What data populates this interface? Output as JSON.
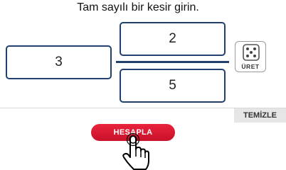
{
  "instruction": "Tam sayılı bir kesir girin.",
  "fraction": {
    "whole": "3",
    "numerator": "2",
    "denominator": "5"
  },
  "buttons": {
    "generate_label": "ÜRET",
    "generate_icon": "dice-icon",
    "clear_label": "TEMİZLE",
    "calculate_label": "HESAPLA"
  },
  "colors": {
    "box_border": "#22406e",
    "calculate_button": "#d81a32",
    "clear_button_bg": "#e6e6e6"
  },
  "cursor": "hand-pointer-icon"
}
